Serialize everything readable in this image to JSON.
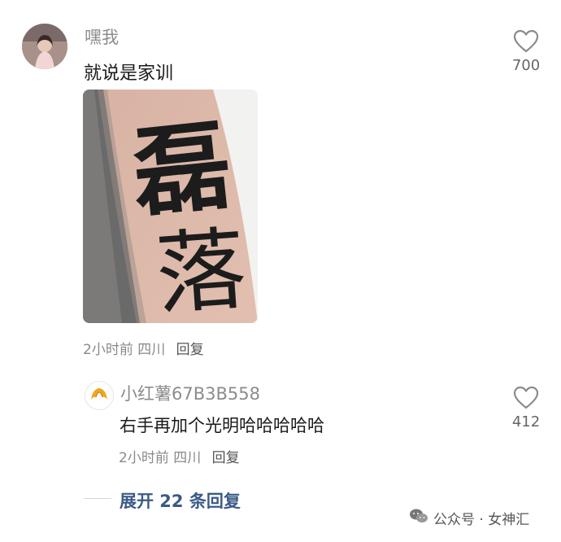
{
  "comment": {
    "username": "嘿我",
    "text": "就说是家训",
    "likes": "700",
    "time": "2小时前",
    "location": "四川",
    "reply_label": "回复",
    "image_text": "磊落"
  },
  "reply": {
    "username": "小红薯67B3B558",
    "text": "右手再加个光明哈哈哈哈哈",
    "likes": "412",
    "time": "2小时前",
    "location": "四川",
    "reply_label": "回复"
  },
  "expand": {
    "label": "展开 22 条回复"
  },
  "watermark": {
    "text": "公众号 · 女神汇"
  },
  "icons": [
    "heart-icon",
    "wechat-icon",
    "croissant-icon"
  ],
  "colors": {
    "link": "#3b5a86",
    "meta": "#8a8a8a"
  }
}
